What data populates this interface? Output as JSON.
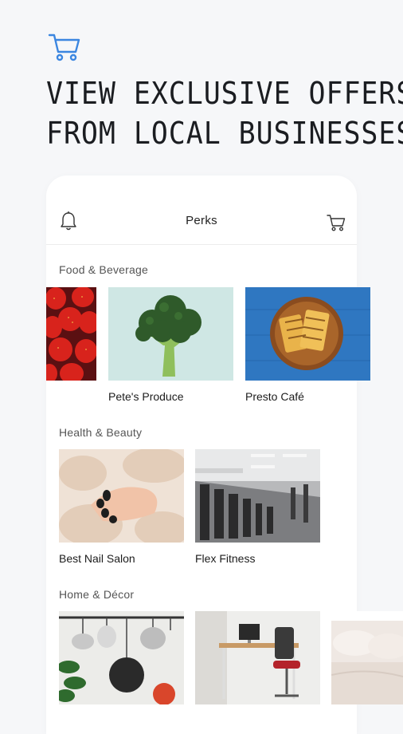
{
  "hero": {
    "icon": "shopping-cart-icon",
    "accent_color": "#3b86e0",
    "headline_line1": "VIEW EXCLUSIVE OFFERS",
    "headline_line2": "FROM LOCAL BUSINESSES"
  },
  "app": {
    "title": "Perks",
    "left_icon": "bell-icon",
    "right_icon": "cart-icon"
  },
  "sections": [
    {
      "title": "Food & Beverage",
      "items": [
        {
          "name": "",
          "image": "strawberries-image"
        },
        {
          "name": "Pete's Produce",
          "image": "broccoli-image"
        },
        {
          "name": "Presto Café",
          "image": "grilled-sandwich-image"
        }
      ]
    },
    {
      "title": "Health & Beauty",
      "items": [
        {
          "name": "Best Nail Salon",
          "image": "manicure-image"
        },
        {
          "name": "Flex Fitness",
          "image": "gym-equipment-image"
        }
      ]
    },
    {
      "title": "Home & Décor",
      "items": [
        {
          "name": "",
          "image": "hanging-pots-image"
        },
        {
          "name": "",
          "image": "home-office-image"
        },
        {
          "name": "",
          "image": "bedroom-image"
        }
      ]
    }
  ]
}
